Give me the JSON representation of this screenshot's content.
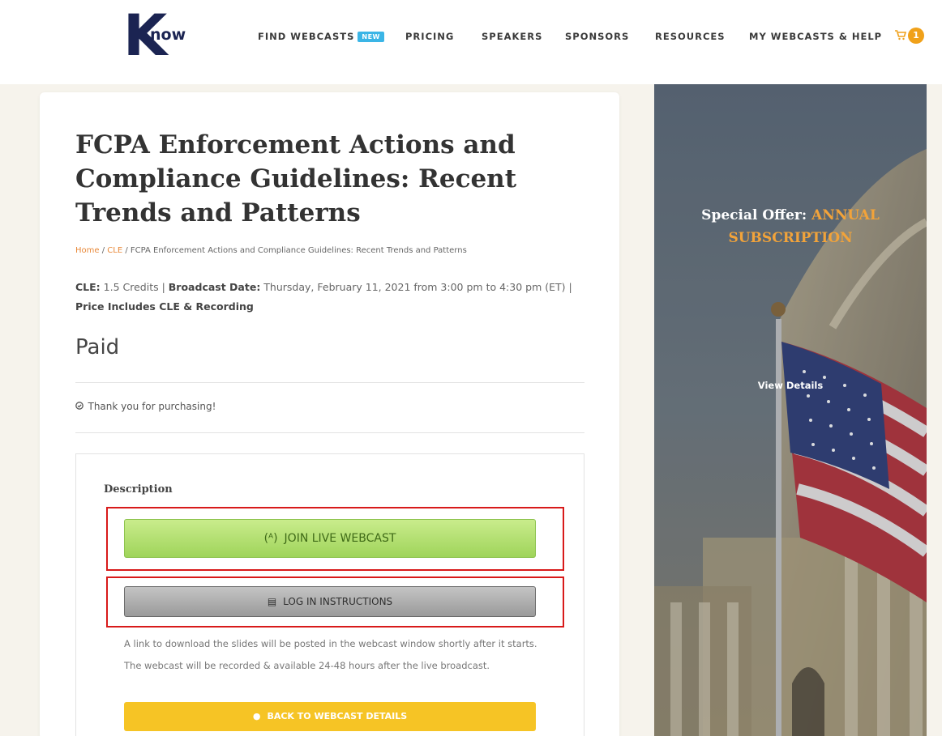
{
  "header": {
    "logo_letter": "K",
    "logo_rest": "now",
    "nav": [
      {
        "label": "FIND WEBCASTS",
        "badge": "NEW"
      },
      {
        "label": "PRICING"
      },
      {
        "label": "SPEAKERS"
      },
      {
        "label": "SPONSORS"
      },
      {
        "label": "RESOURCES"
      },
      {
        "label": "MY WEBCASTS & HELP"
      }
    ],
    "cart_count": "1"
  },
  "page": {
    "title": "FCPA Enforcement Actions and Compliance Guidelines: Recent Trends and Patterns",
    "breadcrumb": {
      "home": "Home",
      "sep1": " / ",
      "cle": "CLE",
      "sep2": " / ",
      "current": "FCPA Enforcement Actions and Compliance Guidelines: Recent Trends and Patterns"
    },
    "meta": {
      "cle_label": "CLE:",
      "cle_value": " 1.5 Credits | ",
      "date_label": "Broadcast Date:",
      "date_value": " Thursday, February 11, 2021 from 3:00 pm to 4:30 pm (ET) |",
      "price_note": "Price Includes CLE & Recording"
    },
    "status": "Paid",
    "thanks_icon": "✓",
    "thanks": "Thank you for purchasing!",
    "description_heading": "Description",
    "join_icon": "(ᴬ)",
    "join_label": "JOIN LIVE WEBCAST",
    "login_icon": "▤",
    "login_label": "LOG IN INSTRUCTIONS",
    "note": "A link to download the slides will be posted in the webcast window shortly after it starts. The webcast will be recorded & available 24-48 hours after the live broadcast.",
    "back_icon": "●",
    "back_label": "BACK TO WEBCAST DETAILS"
  },
  "banner": {
    "offer_prefix": "Special Offer: ",
    "offer_highlight": "ANNUAL SUBSCRIPTION",
    "view_details": "View Details"
  },
  "colors": {
    "brand_navy": "#1b2452",
    "accent_orange": "#f0a11a",
    "join_green": "#9fd45a",
    "back_yellow": "#f6c425",
    "annotation_red": "#d81a1a"
  }
}
